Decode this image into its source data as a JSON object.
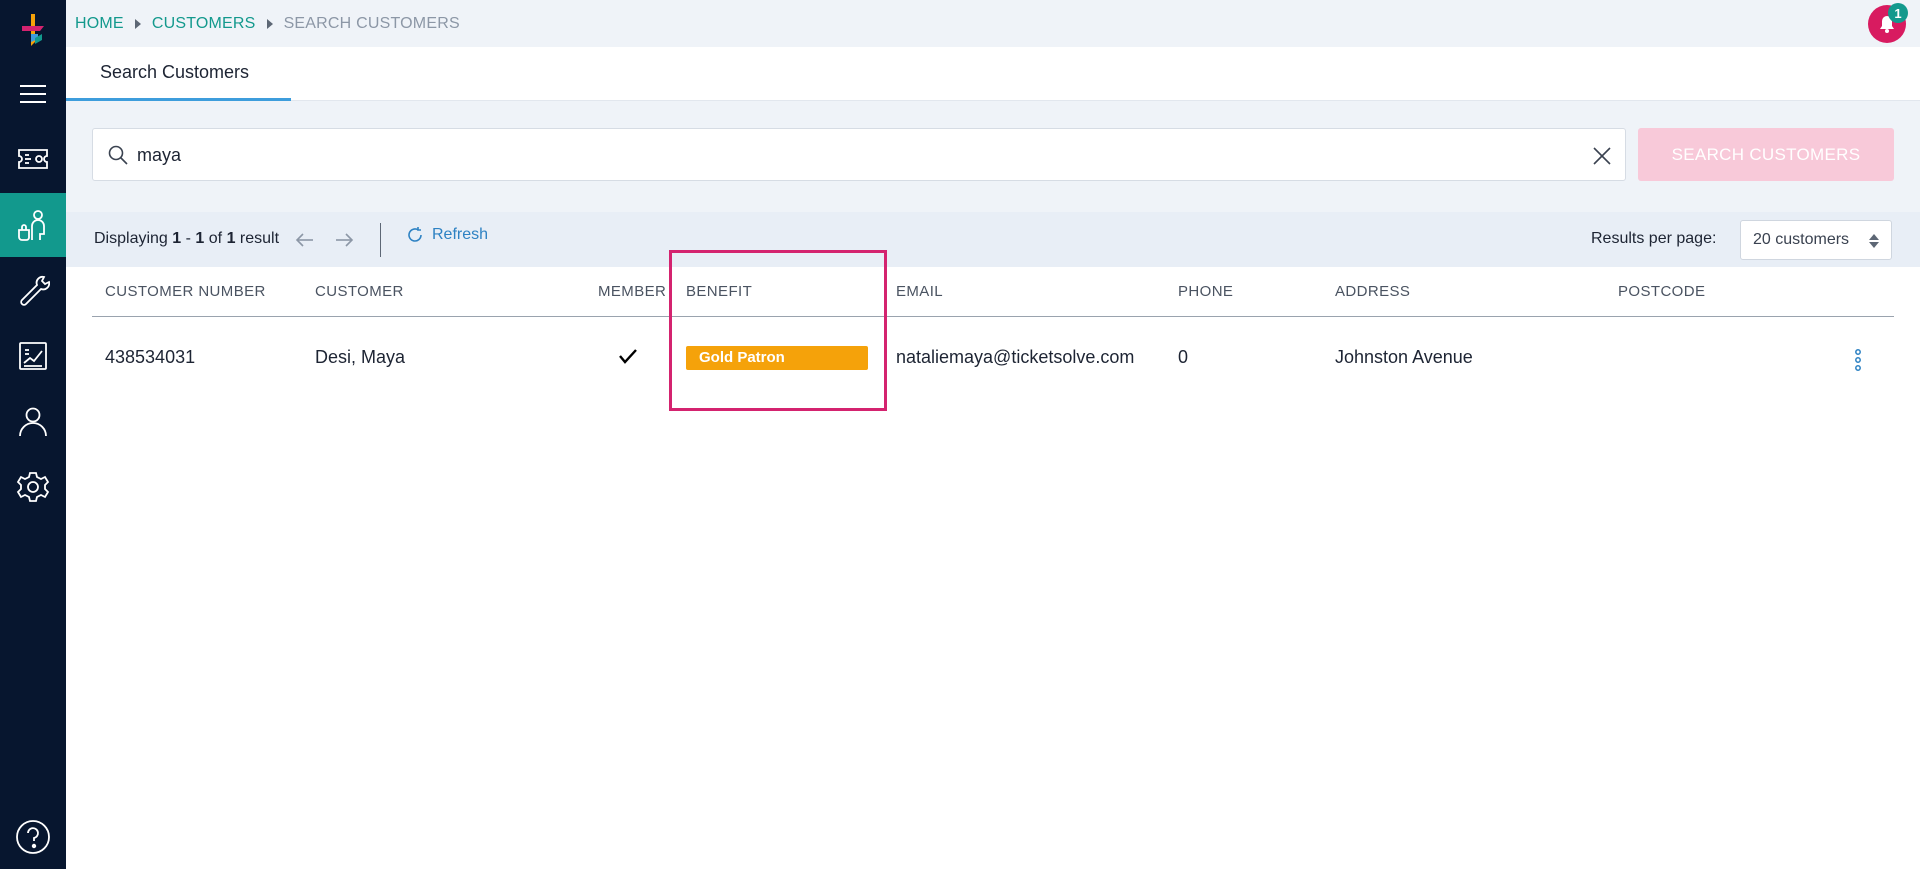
{
  "breadcrumb": {
    "home": "HOME",
    "customers": "CUSTOMERS",
    "current": "SEARCH CUSTOMERS"
  },
  "notifications": {
    "count": "1"
  },
  "tabs": [
    {
      "label": "Search Customers"
    }
  ],
  "search": {
    "value": "maya",
    "placeholder": "",
    "button_label": "SEARCH CUSTOMERS"
  },
  "pager": {
    "prefix": "Displaying",
    "start": "1",
    "sep": "-",
    "end": "1",
    "of": "of",
    "total": "1",
    "suffix": "result",
    "refresh_label": "Refresh",
    "rpp_label": "Results per page:",
    "rpp_value": "20 customers"
  },
  "table": {
    "headers": {
      "customer_number": "CUSTOMER NUMBER",
      "customer": "CUSTOMER",
      "member": "MEMBER",
      "benefit": "BENEFIT",
      "email": "EMAIL",
      "phone": "PHONE",
      "address": "ADDRESS",
      "postcode": "POSTCODE"
    },
    "rows": [
      {
        "customer_number": "438534031",
        "customer": "Desi, Maya",
        "member": true,
        "benefit": "Gold Patron",
        "email": "nataliemaya@ticketsolve.com",
        "phone": "0",
        "address": "Johnston Avenue",
        "postcode": ""
      }
    ]
  },
  "colors": {
    "sidebar": "#07162f",
    "accent_teal": "#12998d",
    "badge_gold": "#f5a20a",
    "highlight": "#d4236f",
    "search_button": "#f8c9d9"
  },
  "icons": [
    "menu-icon",
    "ticket-icon",
    "customers-icon",
    "wrench-icon",
    "reports-icon",
    "user-icon",
    "gear-icon",
    "help-icon",
    "bell-icon",
    "search-icon",
    "close-icon",
    "arrow-left-icon",
    "arrow-right-icon",
    "refresh-icon",
    "checkmark-icon",
    "kebab-icon"
  ]
}
